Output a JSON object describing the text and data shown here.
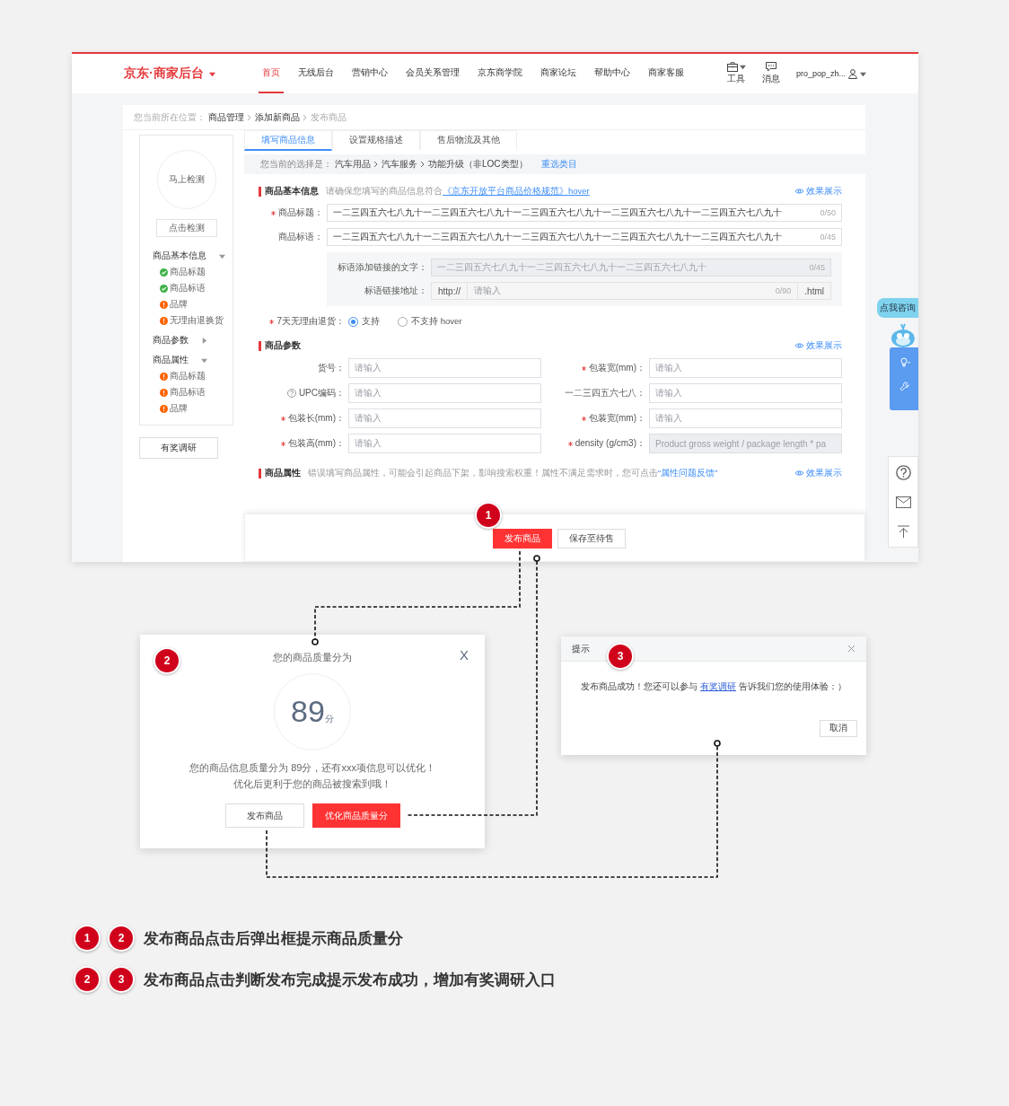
{
  "screen": {
    "header": {
      "logo": "京东·商家后台",
      "nav": [
        {
          "label": "首页",
          "selected": true
        },
        {
          "label": "无线后台",
          "selected": false
        },
        {
          "label": "营销中心",
          "selected": false
        },
        {
          "label": "会员关系管理",
          "selected": false
        },
        {
          "label": "京东商学院",
          "selected": false
        },
        {
          "label": "商家论坛",
          "selected": false
        },
        {
          "label": "帮助中心",
          "selected": false
        },
        {
          "label": "商家客服",
          "selected": false
        }
      ],
      "tools": [
        {
          "kind": "toolbox",
          "label": "工具"
        },
        {
          "kind": "message",
          "label": "消息"
        }
      ],
      "user": "pro_pop_zh..."
    },
    "breadcrumb": {
      "prefix": "您当前所在位置：",
      "items": [
        {
          "label": "商品管理",
          "current": false
        },
        {
          "label": "添加新商品",
          "current": false
        },
        {
          "label": "发布商品",
          "current": true
        }
      ]
    },
    "sidebar": {
      "check_circle": "马上检测",
      "check_button": "点击检测",
      "sections": [
        {
          "title": "商品基本信息",
          "expanded": true,
          "items": [
            {
              "label": "商品标题",
              "kind": "done"
            },
            {
              "label": "商品标语",
              "kind": "done"
            },
            {
              "label": "品牌",
              "kind": "pending"
            },
            {
              "label": "无理由退换货",
              "kind": "pending"
            }
          ]
        },
        {
          "title": "商品参数",
          "expanded": false
        },
        {
          "title": "商品属性",
          "expanded": true,
          "items": [
            {
              "label": "商品标题",
              "kind": "pending"
            },
            {
              "label": "商品标语",
              "kind": "pending"
            },
            {
              "label": "品牌",
              "kind": "pending"
            }
          ]
        }
      ],
      "survey_button": "有奖调研"
    },
    "tabs": [
      {
        "label": "填写商品信息",
        "selected": true
      },
      {
        "label": "设置规格描述",
        "selected": false
      },
      {
        "label": "售后物流及其他",
        "selected": false
      }
    ],
    "category": {
      "prefix": "您当前的选择是：",
      "path": [
        "汽车用品",
        "汽车服务",
        "功能升级（非LOC类型）"
      ],
      "action": "重选类目"
    },
    "basic_info": {
      "title": "商品基本信息",
      "hint": "请确保您填写的商品信息符合",
      "hint_link": "《京东开放平台商品价格规范》hover",
      "preview": "效果展示",
      "fields": [
        {
          "label": "商品标题：",
          "required": true,
          "value": "一二三四五六七八九十一二三四五六七八九十一二三四五六七八九十一二三四五六七八九十一二三四五六七八九十",
          "counter": "0/50"
        },
        {
          "label": "商品标语：",
          "required": false,
          "value": "一二三四五六七八九十一二三四五六七八九十一二三四五六七八九十一二三四五六七八九十一二三四五六七八九十",
          "counter": "0/45"
        }
      ],
      "link_box": {
        "text_label": "标语添加链接的文字：",
        "text_placeholder": "一二三四五六七八九十一二三四五六七八九十一二三四五六七八九十",
        "text_counter": "0/45",
        "url_label": "标语链接地址：",
        "url_prefix": "http://",
        "url_placeholder": "请输入",
        "url_counter": "0/90",
        "url_suffix": ".html"
      },
      "return_policy": {
        "label": "7天无理由退货：",
        "required": true,
        "options": [
          {
            "label": "支持",
            "selected": true
          },
          {
            "label": "不支持 hover",
            "selected": false
          }
        ]
      }
    },
    "params": {
      "title": "商品参数",
      "preview": "效果展示",
      "fields": [
        {
          "label": "货号：",
          "required": false,
          "help": false,
          "disabled": false,
          "placeholder": "请输入"
        },
        {
          "label": "包装宽(mm)：",
          "required": true,
          "help": false,
          "disabled": false,
          "placeholder": "请输入"
        },
        {
          "label": "UPC编码：",
          "required": false,
          "help": true,
          "disabled": false,
          "placeholder": "请输入"
        },
        {
          "label": "一二三四五六七八：",
          "required": false,
          "help": false,
          "disabled": false,
          "placeholder": "请输入"
        },
        {
          "label": "包装长(mm)：",
          "required": true,
          "help": false,
          "disabled": false,
          "placeholder": "请输入"
        },
        {
          "label": "包装宽(mm)：",
          "required": true,
          "help": false,
          "disabled": false,
          "placeholder": "请输入"
        },
        {
          "label": "包装高(mm)：",
          "required": true,
          "help": false,
          "disabled": false,
          "placeholder": "请输入"
        },
        {
          "label": "density (g/cm3)：",
          "required": true,
          "help": false,
          "disabled": true,
          "placeholder": "Product gross weight / package length * pa"
        }
      ]
    },
    "attributes": {
      "title": "商品属性",
      "hint": "错误填写商品属性，可能会引起商品下架，影响搜索权重！属性不满足需求时，您可点击",
      "hint_link": "“属性问题反馈”",
      "preview": "效果展示"
    },
    "footer": {
      "badge": "1",
      "buttons": [
        {
          "label": "发布商品",
          "kind": "primary"
        },
        {
          "label": "保存至待售",
          "kind": "default"
        }
      ]
    },
    "float_tools": {
      "consult": "点我咨询"
    }
  },
  "quality_dialog": {
    "badge": "2",
    "title": "您的商品质量分为",
    "close": "X",
    "score": "89",
    "score_unit": "分",
    "message": [
      "您的商品信息质量分为 89分，还有xxx项信息可以优化！",
      "优化后更利于您的商品被搜索到哦！"
    ],
    "buttons": [
      {
        "label": "发布商品",
        "kind": "default"
      },
      {
        "label": "优化商品质量分",
        "kind": "primary"
      }
    ]
  },
  "success_dialog": {
    "badge": "3",
    "title": "提示",
    "message_before": "发布商品成功！您还可以参与",
    "link": "有奖调研",
    "message_after": "告诉我们您的使用体验：）",
    "button": "取消"
  },
  "legend": [
    {
      "badges": [
        "1",
        "2"
      ],
      "text": "发布商品点击后弹出框提示商品质量分"
    },
    {
      "badges": [
        "2",
        "3"
      ],
      "text": "发布商品点击判断发布完成提示发布成功，增加有奖调研入口"
    }
  ]
}
